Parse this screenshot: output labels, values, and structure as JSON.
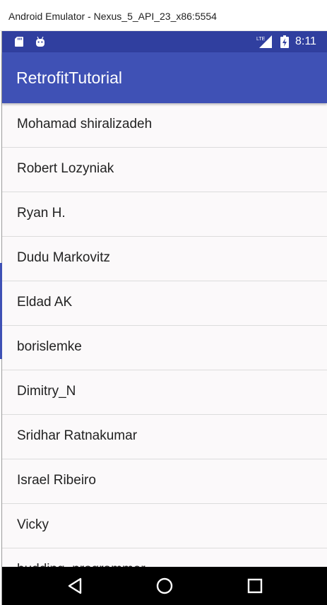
{
  "window": {
    "title": "Android Emulator - Nexus_5_API_23_x86:5554"
  },
  "status_bar": {
    "time": "8:11",
    "network": "LTE",
    "icons": [
      "sd-card-icon",
      "android-icon",
      "lte-signal-icon",
      "battery-icon"
    ]
  },
  "app_bar": {
    "title": "RetrofitTutorial"
  },
  "list": {
    "items": [
      "Mohamad shiralizadeh",
      "Robert Lozyniak",
      "Ryan H.",
      "Dudu Markovitz",
      "Eldad AK",
      "borislemke",
      "Dimitry_N",
      "Sridhar Ratnakumar",
      "Israel Ribeiro",
      "Vicky",
      "budding_programmer"
    ]
  },
  "nav_bar": {
    "buttons": [
      "back-icon",
      "home-icon",
      "recents-icon"
    ]
  },
  "colors": {
    "status_bar": "#303f9f",
    "app_bar": "#3f51b5",
    "list_background": "#fbf9fa",
    "divider": "#dcdcdc",
    "nav_bar": "#000000"
  }
}
